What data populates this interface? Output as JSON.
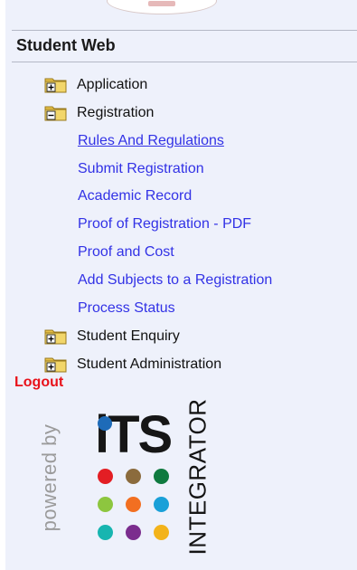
{
  "header": {
    "title": "Student Web"
  },
  "menu": {
    "folders": [
      {
        "label": "Application",
        "state": "collapsed"
      },
      {
        "label": "Registration",
        "state": "expanded"
      },
      {
        "label": "Student Enquiry",
        "state": "collapsed"
      },
      {
        "label": "Student Administration",
        "state": "collapsed"
      }
    ],
    "registration_links": [
      {
        "label": "Rules And Regulations"
      },
      {
        "label": "Submit Registration"
      },
      {
        "label": "Academic Record"
      },
      {
        "label": "Proof of Registration - PDF"
      },
      {
        "label": "Proof and Cost"
      },
      {
        "label": "Add Subjects to a Registration"
      },
      {
        "label": "Process Status"
      }
    ]
  },
  "logout": {
    "label": "Logout"
  },
  "branding": {
    "powered_by": "powered by",
    "its": "iTS",
    "integrator": "INTEGRATOR",
    "dot_colors": [
      "#e31e24",
      "#8b6b3d",
      "#0f7a3f",
      "#8dc63f",
      "#f26f21",
      "#1aa0d8",
      "#17b5b0",
      "#7b2d8e",
      "#f3b31a"
    ],
    "i_dot_color": "#1e6bb8"
  },
  "colors": {
    "link": "#3232e6",
    "logout": "#e8121a",
    "panel_bg": "#eef1fb"
  }
}
